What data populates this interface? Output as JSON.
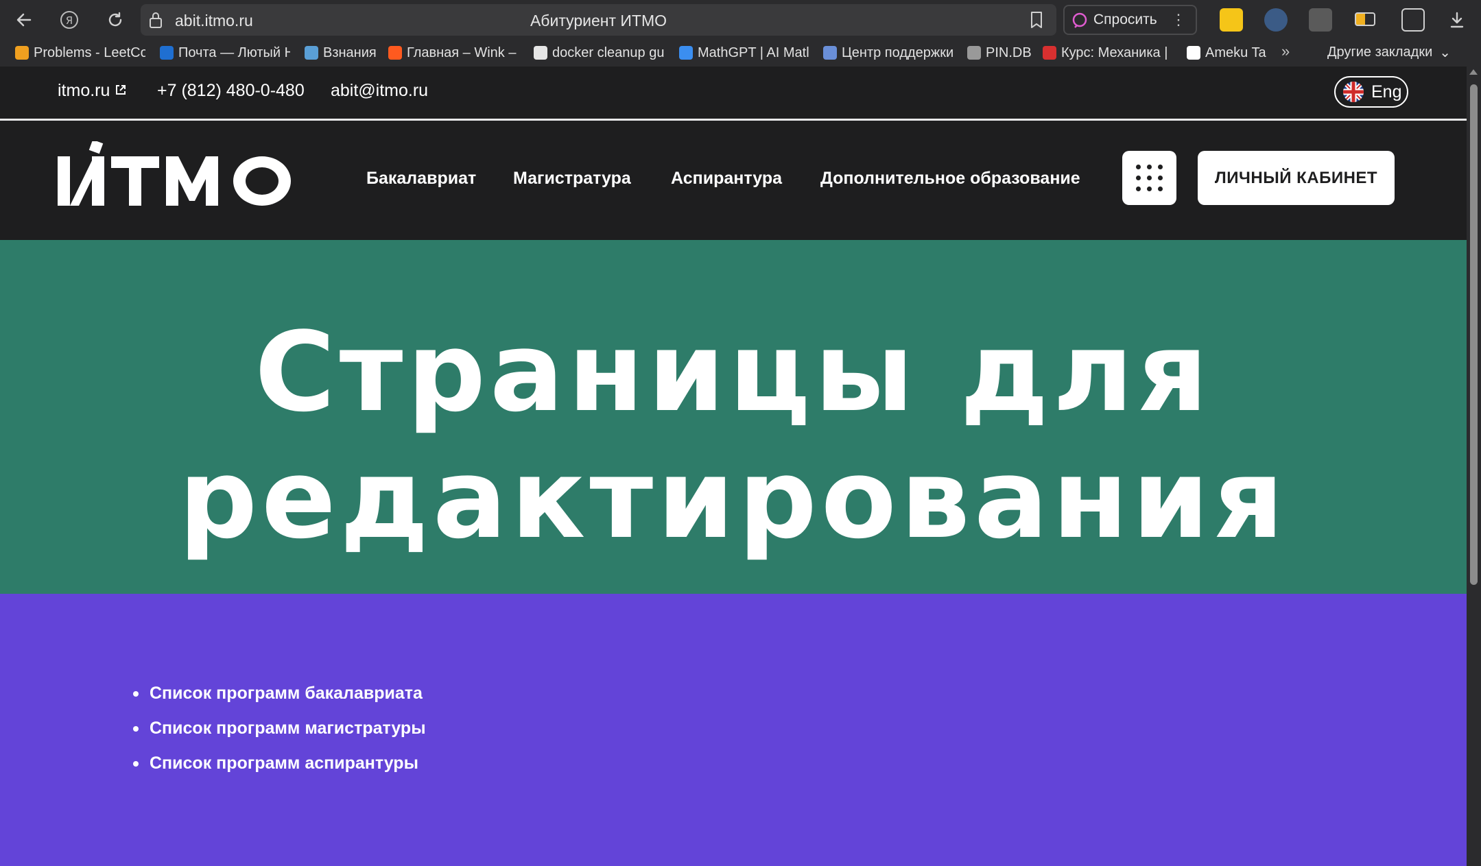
{
  "browser": {
    "tab_title": "Абитуриент ИТМО",
    "url": "abit.itmo.ru",
    "ask_label": "Спросить",
    "toolbar_icons": [
      "back-icon",
      "yandex-icon",
      "reload-icon",
      "lock-icon",
      "bookmark-icon",
      "downloads-icon"
    ],
    "bookmarks": [
      {
        "label": "Problems - LeetCo",
        "icon": "leetcode-icon",
        "color": "#f0a020"
      },
      {
        "label": "Почта — Лютый Н",
        "icon": "outlook-icon",
        "color": "#1f6fd1"
      },
      {
        "label": "Взнания",
        "icon": "globe-icon",
        "color": "#5a9fd6"
      },
      {
        "label": "Главная – Wink – ",
        "icon": "wink-icon",
        "color": "#ff5a1f"
      },
      {
        "label": "docker cleanup gu",
        "icon": "github-icon",
        "color": "#e6e6e6"
      },
      {
        "label": "MathGPT | AI Matl",
        "icon": "mathgpt-icon",
        "color": "#3b8ef0"
      },
      {
        "label": "Центр поддержки",
        "icon": "support-icon",
        "color": "#6a8fd8"
      },
      {
        "label": "PIN.DB",
        "icon": "pdb-icon",
        "color": "#999999"
      },
      {
        "label": "Курс: Механика | ",
        "icon": "course-icon",
        "color": "#d83030"
      },
      {
        "label": "Ameku Ta",
        "icon": "ameku-icon",
        "color": "#ffffff"
      }
    ],
    "bookmarks_overflow": "»",
    "other_bookmarks": "Другие закладки"
  },
  "topbar": {
    "site_link": "itmo.ru",
    "phone": "+7 (812) 480-0-480",
    "email": "abit@itmo.ru",
    "lang": "Eng"
  },
  "navbar": {
    "logo_text": "ИТМО",
    "items": [
      "Бакалавриат",
      "Магистратура",
      "Аспирантура",
      "Дополнительное образование"
    ],
    "cabinet_label": "ЛИЧНЫЙ КАБИНЕТ"
  },
  "hero": {
    "title_line1": "Страницы для",
    "title_line2": "редактирования"
  },
  "programs": {
    "items": [
      "Список программ бакалавриата",
      "Список программ магистратуры",
      "Список программ аспирантуры"
    ]
  },
  "colors": {
    "page_dark": "#1e1e1f",
    "hero_green": "#2e7c69",
    "section_purple": "#6344d8"
  }
}
